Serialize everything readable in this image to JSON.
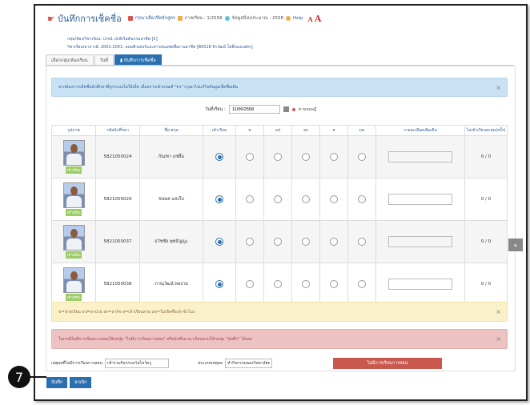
{
  "header": {
    "title": "บันทึกการเช็คชื่อ",
    "course_hint": "กรุณาเลือกปีหลักสูตร",
    "semester": "ภาคเรียน : 1/2558",
    "updated": "ข้อมูลปีงบประมาณ : 2558",
    "help": "Help",
    "aa_small": "A",
    "aa_big": "A"
  },
  "subinfo": {
    "line1": "กลุ่ม/ห้อง/วิชาเรียน: ปวช1 ปกติเริ่มต้นกรมอาชีพ [2]",
    "line2": "วิชาเรียน/อาจารย์: 2001-2001: คอมพิวเตอร์และสารสนเทศเพื่องานอาชีพ [B0018 จิรวัฒน์ โพธิ์ทองแพทร]"
  },
  "tabs": [
    {
      "label": "เลือกกลุ่ม/ห้องเรียน"
    },
    {
      "label": "วันที่"
    },
    {
      "label": "บันทึกการเช็คชื่อ"
    }
  ],
  "alerts": {
    "info": "หากต้องการเช็คชื่อนักศึกษาที่ถูกระบบไม่ให้เช็ค เนื่องจากเข้าเกณฑ์ \"ขร\" กรุณาไปแก้ไขข้อมูลเช็คชื่อเดิม",
    "warn": "ข=ขาดเรียน ลป=ลาป่วย ลก=ลากิจ ส=เข้าเรียนสาย มข=ไม่เช็คชื่อเข้าชั่วโมง",
    "danger": "ในกรณีไม่มีการเรียนการสอนให้กดปุ่ม \"ไม่มีการเรียนการสอน\" หรือนักศึกษามาเรียนครบให้กดปุ่ม \"บันทึก\" ได้เลย",
    "close": "×"
  },
  "date": {
    "label": "วันที่เรียน :",
    "value": "11/06/2558",
    "hint": "ตามทฤษฎี"
  },
  "table": {
    "headers": [
      "รูปภาพ",
      "รหัสนักศึกษา",
      "ชื่อ-สกุล",
      "เข้าเรียน",
      "ข",
      "ลป",
      "ลก",
      "ส",
      "มข",
      "รายละเอียดเพิ่มเติม",
      "ไม่เข้าเรียนสะสม(ครั้ง)"
    ],
    "badge": "เข้าเรียน",
    "rows": [
      {
        "id": "5821050024",
        "name": "กัณฑา แซ่ลิ้ม",
        "absent": "0 / 0",
        "selected": 0
      },
      {
        "id": "5821050029",
        "name": "ชนพล แสงใบ",
        "absent": "0 / 0",
        "selected": 0
      },
      {
        "id": "5821050037",
        "name": "ธวัชชัย พุทธัญญะ",
        "absent": "0 / 0",
        "selected": 0
      },
      {
        "id": "5821050038",
        "name": "ภาณุวัฒน์ พลงาม",
        "absent": "0 / 0",
        "selected": 0
      }
    ]
  },
  "bottom": {
    "reason_label": "เหตุผลที่ไม่มีการเรียนการสอน",
    "reason_value": "เข้าร่วมกิจกรรมวันไหว้ครู",
    "type_label": "ประเภทเหตุผล",
    "type_value": "ทำกิจกรรมของวิทยาลัย",
    "no_class_button": "ไม่มีการเรียนการสอน"
  },
  "buttons": {
    "save": "บันทึก",
    "cancel": "ยกเลิก"
  },
  "marker": "7",
  "colors": {
    "primary": "#2a6fb0",
    "danger": "#c9594f",
    "success": "#9ccc65"
  }
}
